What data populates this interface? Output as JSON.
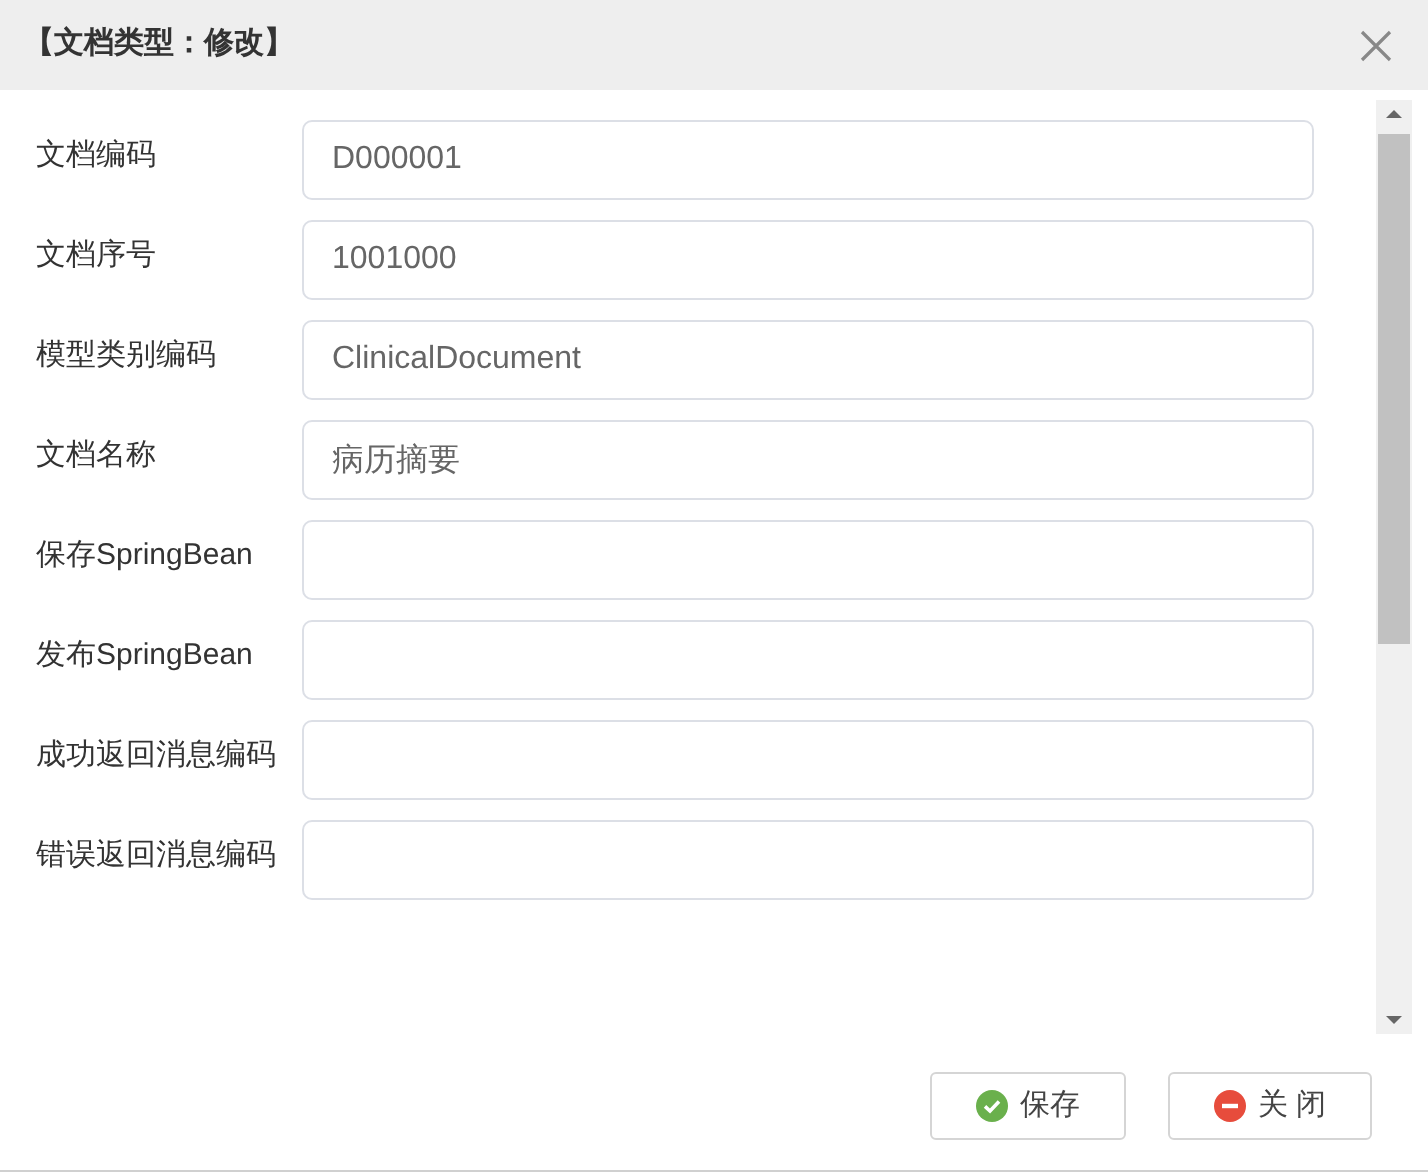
{
  "window": {
    "title": "【文档类型：修改】"
  },
  "fields": [
    {
      "label": "文档编码",
      "value": "D000001"
    },
    {
      "label": "文档序号",
      "value": "1001000"
    },
    {
      "label": "模型类别编码",
      "value": "ClinicalDocument"
    },
    {
      "label": "文档名称",
      "value": "病历摘要"
    },
    {
      "label": "保存SpringBean"
    },
    {
      "label": "发布SpringBean"
    },
    {
      "label": "成功返回消息编码"
    },
    {
      "label": "错误返回消息编码"
    }
  ],
  "buttons": [
    {
      "label": "保存",
      "kind": "save"
    },
    {
      "label": "关 闭",
      "kind": "close"
    }
  ]
}
